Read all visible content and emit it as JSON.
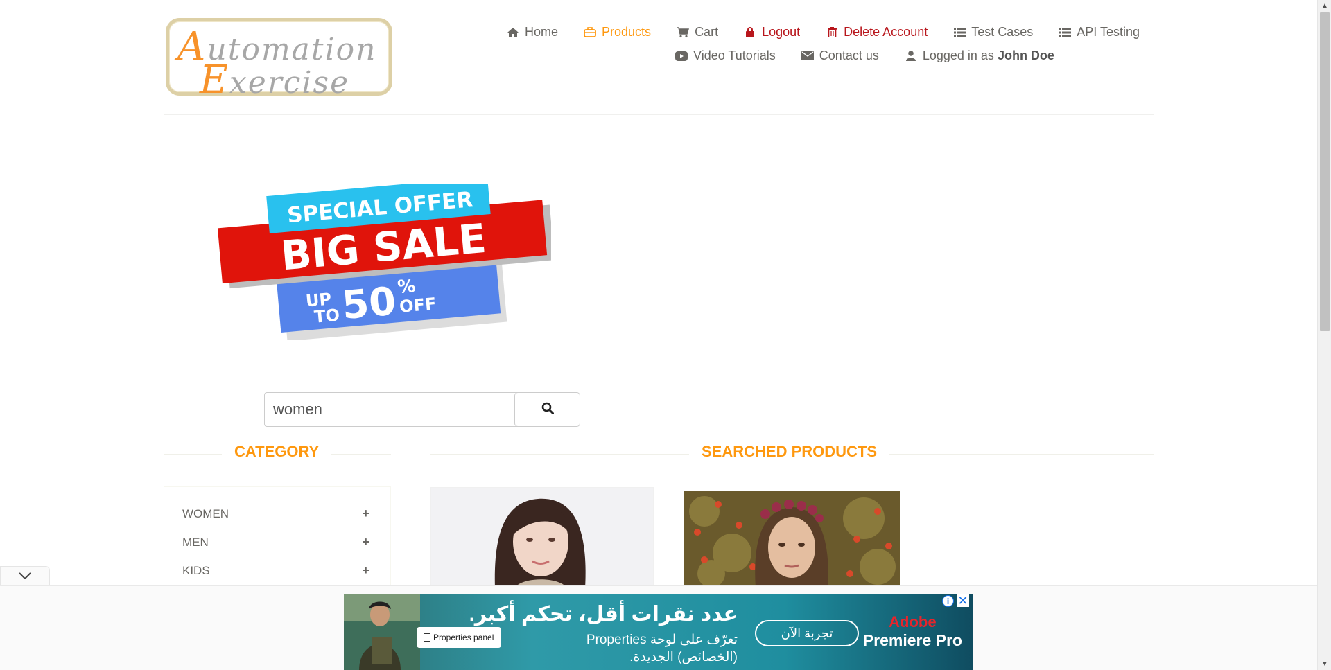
{
  "logo": {
    "line1_cap": "A",
    "line1_rest": "utomation",
    "line2_cap": "E",
    "line2_rest": "xercise"
  },
  "nav": {
    "home": "Home",
    "products": "Products",
    "cart": "Cart",
    "logout": "Logout",
    "delete_account": "Delete Account",
    "test_cases": "Test Cases",
    "api_testing": "API Testing",
    "video_tutorials": "Video Tutorials",
    "contact_us": "Contact us",
    "logged_in_prefix": "Logged in as",
    "logged_in_user": "John Doe"
  },
  "banner": {
    "line1": "SPECIAL OFFER",
    "line2": "BIG SALE",
    "up": "UP",
    "to": "TO",
    "percent": "50",
    "percent_sign": "%",
    "off": "OFF"
  },
  "search": {
    "value": "women"
  },
  "category": {
    "title": "CATEGORY",
    "items": [
      {
        "label": "WOMEN"
      },
      {
        "label": "MEN"
      },
      {
        "label": "KIDS"
      }
    ]
  },
  "products": {
    "title": "SEARCHED PRODUCTS"
  },
  "ad": {
    "chip": "Properties panel",
    "headline": "عدد نقرات أقل، تحكم أكبر.",
    "sub1": "تعرّف على لوحة Properties",
    "sub2": "(الخصائص) الجديدة.",
    "cta": "تجربة الآن",
    "brand1": "Adobe",
    "brand2": "Premiere Pro",
    "info": "i",
    "close": "✕"
  },
  "colors": {
    "accent": "#fe980f",
    "danger": "#b8161c",
    "text": "#696763"
  }
}
